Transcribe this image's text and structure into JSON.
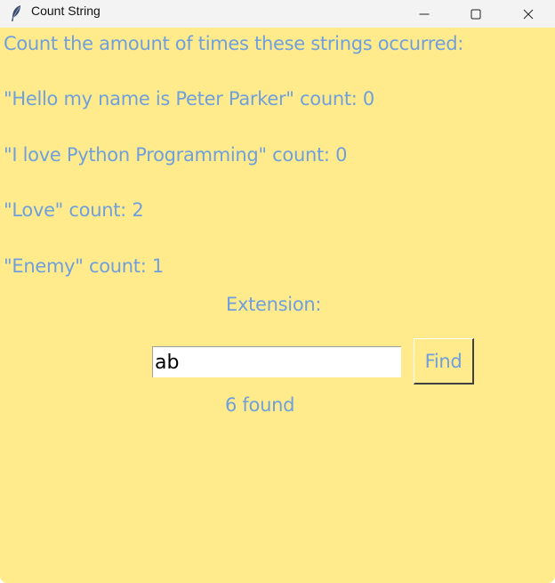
{
  "window": {
    "title": "Count String",
    "icon": "feather-icon",
    "controls": [
      "minimize-icon",
      "maximize-icon",
      "close-icon"
    ]
  },
  "content": {
    "heading": "Count the amount of times these strings occurred:",
    "counts": [
      "\"Hello my name is Peter Parker\" count: 0",
      "\"I love Python Programming\" count: 0",
      "\"Love\" count: 2",
      "\"Enemy\" count: 1"
    ],
    "extension_label": "Extension:",
    "search_value": "ab",
    "find_label": "Find",
    "result": "6 found"
  },
  "colors": {
    "background": "#ffeb8c",
    "text": "#6f9fdc",
    "titlebar": "#f3f3f3"
  }
}
